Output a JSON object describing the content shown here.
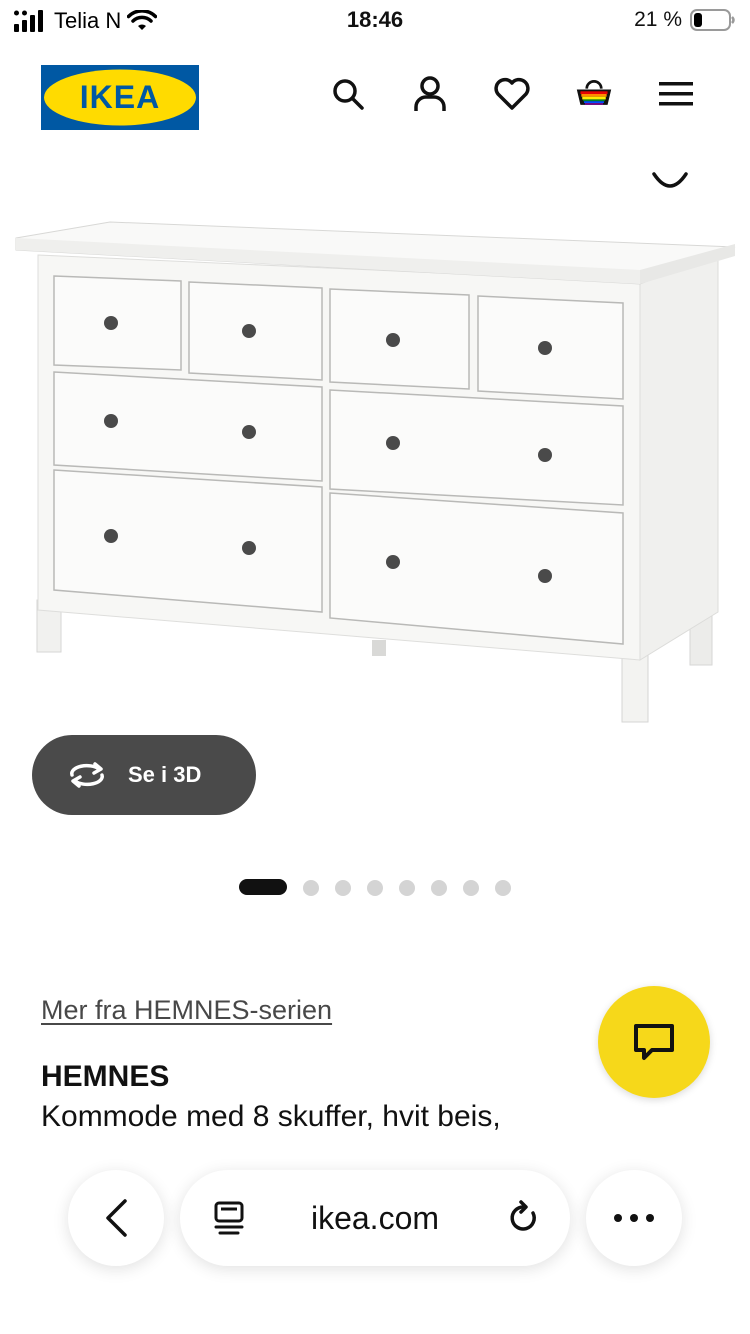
{
  "status_bar": {
    "carrier": "Telia N",
    "time": "18:46",
    "battery": "21 %"
  },
  "header": {
    "logo_text": "IKEA",
    "icons": [
      "search-icon",
      "account-icon",
      "heart-icon",
      "basket-icon",
      "menu-icon"
    ]
  },
  "gallery": {
    "view_3d_label": "Se i 3D",
    "total_images": 8,
    "active_index": 0
  },
  "product": {
    "series_link": "Mer fra HEMNES-serien",
    "name": "HEMNES",
    "description": "Kommode med 8 skuffer, hvit beis,"
  },
  "browser": {
    "url": "ikea.com"
  },
  "colors": {
    "ikea_blue": "#0058a3",
    "ikea_yellow": "#ffdb00",
    "chat_yellow": "#f6d81a",
    "button_dark": "#4a4a4a"
  }
}
